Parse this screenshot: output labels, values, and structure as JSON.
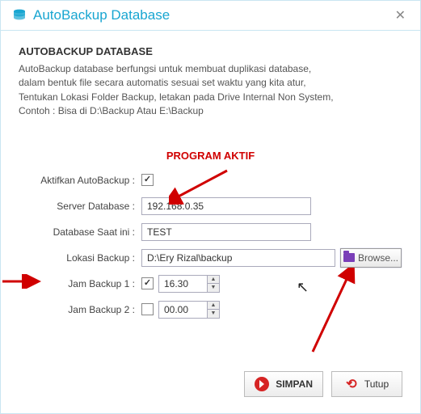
{
  "title": "AutoBackup Database",
  "heading": "AUTOBACKUP DATABASE",
  "desc_lines": [
    "AutoBackup database berfungsi untuk membuat duplikasi database,",
    "dalam bentuk file secara automatis sesuai set waktu yang kita atur,",
    "Tentukan Lokasi Folder Backup, letakan pada Drive Internal Non System,",
    "Contoh : Bisa di D:\\Backup Atau E:\\Backup"
  ],
  "status_text": "PROGRAM AKTIF",
  "form": {
    "enable_label": "Aktifkan AutoBackup :",
    "enable_checked": true,
    "server_label": "Server Database :",
    "server_value": "192.168.0.35",
    "dbname_label": "Database Saat ini :",
    "dbname_value": "TEST",
    "location_label": "Lokasi Backup :",
    "location_value": "D:\\Ery Rizal\\backup",
    "browse_label": "Browse...",
    "jam1_label": "Jam Backup 1 :",
    "jam1_checked": true,
    "jam1_value": "16.30",
    "jam2_label": "Jam Backup 2 :",
    "jam2_checked": false,
    "jam2_value": "00.00"
  },
  "footer": {
    "save": "SIMPAN",
    "close": "Tutup"
  }
}
